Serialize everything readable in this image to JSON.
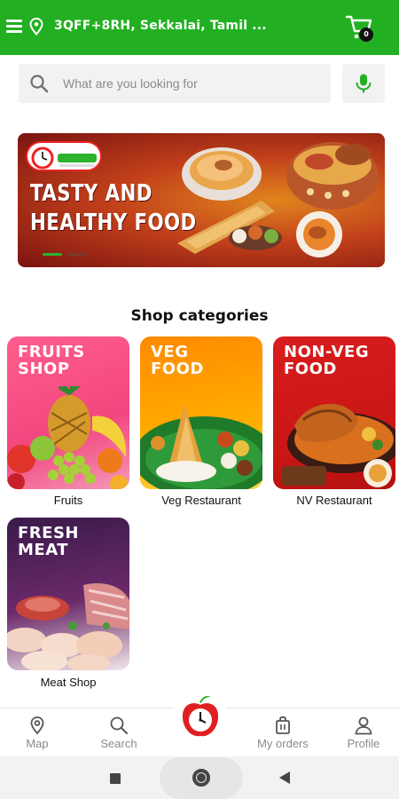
{
  "header": {
    "location": "3QFF+8RH, Sekkalai, Tamil ...",
    "cart_count": "0",
    "colors": {
      "bar": "#22b022"
    },
    "icons": [
      "menu-icon",
      "location-pin-icon",
      "cart-icon"
    ]
  },
  "search": {
    "placeholder": "What are you looking for",
    "value": "",
    "icons": [
      "search-icon",
      "microphone-icon"
    ],
    "mic_color": "#22b022"
  },
  "banner": {
    "title_line1": "TASTY AND",
    "title_line2": "HEALTHY FOOD"
  },
  "categories": {
    "title": "Shop categories",
    "items": [
      {
        "card_title": "FRUITS SHOP",
        "label": "Fruits",
        "color": "#f2467e"
      },
      {
        "card_title": "VEG FOOD",
        "label": "Veg Restaurant",
        "color": "#ffa000"
      },
      {
        "card_title": "NON-VEG FOOD",
        "label": "NV Restaurant",
        "color": "#d01818"
      },
      {
        "card_title": "FRESH MEAT",
        "label": "Meat Shop",
        "color": "#4a1e5a"
      }
    ]
  },
  "bottom_nav": {
    "items": [
      {
        "label": "Map",
        "icon": "map-pin-icon"
      },
      {
        "label": "Search",
        "icon": "search-icon"
      },
      {
        "label": "My orders",
        "icon": "shopping-bag-icon"
      },
      {
        "label": "Profile",
        "icon": "profile-icon"
      }
    ],
    "center_icon": "apple-clock-logo-icon"
  }
}
